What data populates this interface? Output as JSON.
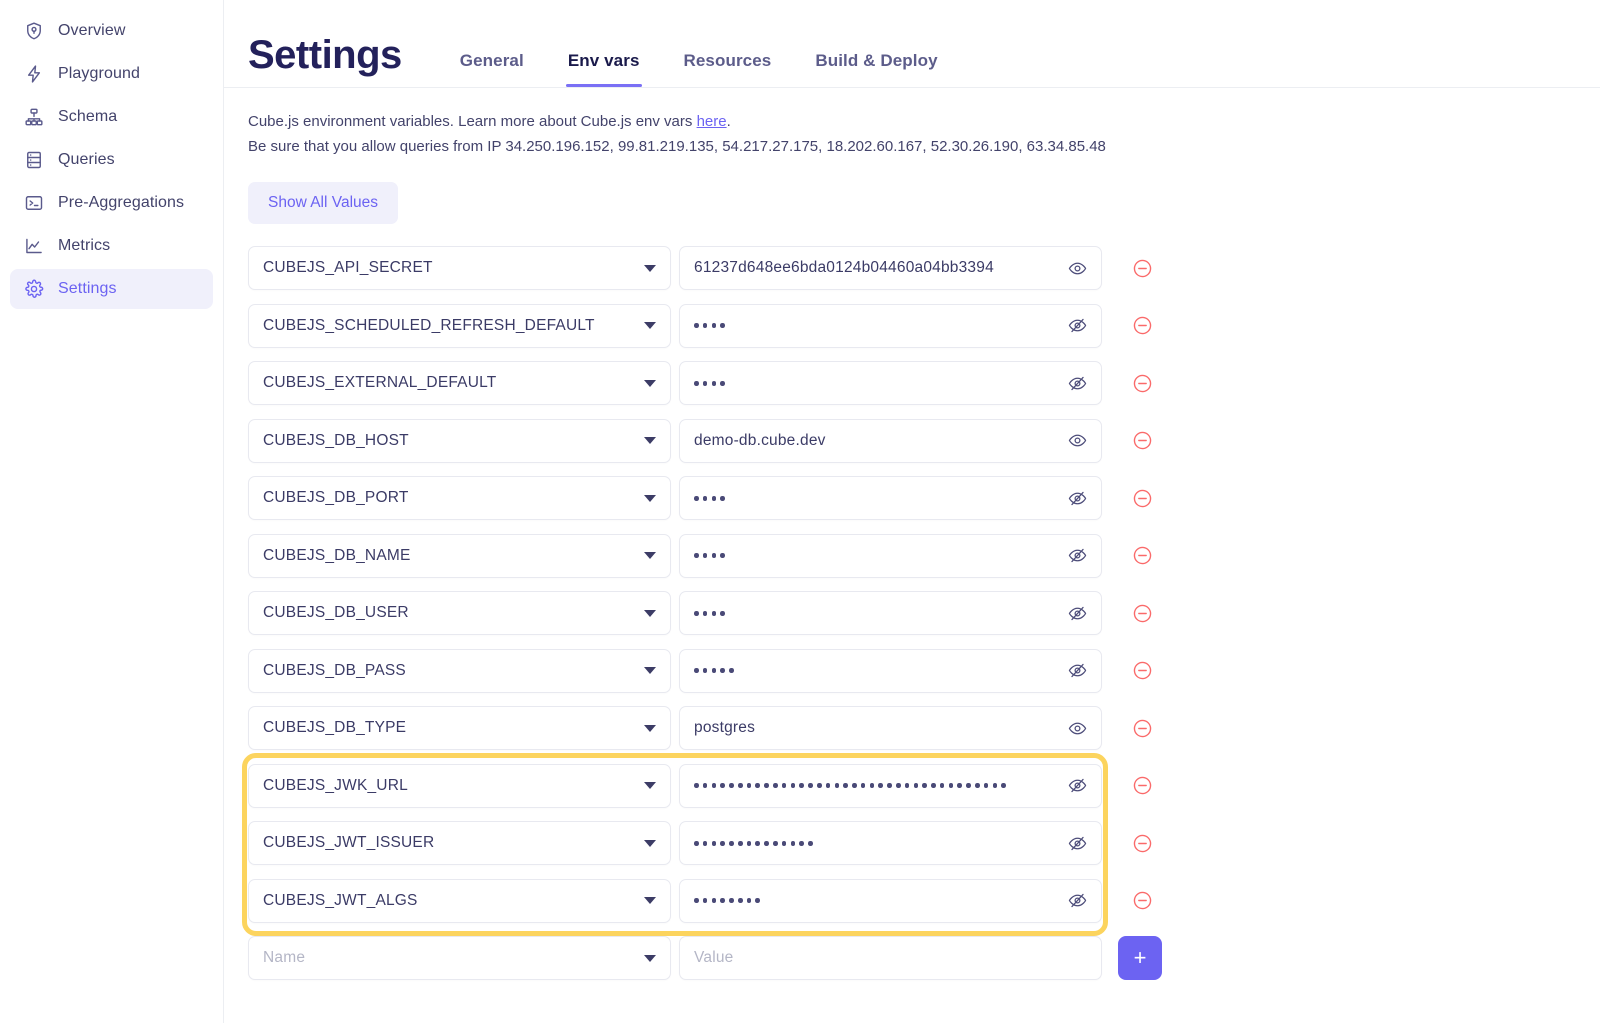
{
  "sidebar": {
    "items": [
      {
        "label": "Overview",
        "icon": "shield-overview-icon",
        "active": false
      },
      {
        "label": "Playground",
        "icon": "lightning-icon",
        "active": false
      },
      {
        "label": "Schema",
        "icon": "schema-tree-icon",
        "active": false
      },
      {
        "label": "Queries",
        "icon": "server-list-icon",
        "active": false
      },
      {
        "label": "Pre-Aggregations",
        "icon": "terminal-icon",
        "active": false
      },
      {
        "label": "Metrics",
        "icon": "line-chart-icon",
        "active": false
      },
      {
        "label": "Settings",
        "icon": "gear-icon",
        "active": true
      }
    ]
  },
  "header": {
    "title": "Settings",
    "tabs": [
      {
        "label": "General",
        "active": false
      },
      {
        "label": "Env vars",
        "active": true
      },
      {
        "label": "Resources",
        "active": false
      },
      {
        "label": "Build & Deploy",
        "active": false
      }
    ]
  },
  "description": {
    "line1_before_link": "Cube.js environment variables. Learn more about Cube.js env vars ",
    "link_text": "here",
    "line1_after_link": ".",
    "line2": "Be sure that you allow queries from IP 34.250.196.152, 99.81.219.135, 54.217.27.175, 18.202.60.167, 52.30.26.190, 63.34.85.48"
  },
  "toolbar": {
    "show_all_label": "Show All Values"
  },
  "env_vars": [
    {
      "name": "CUBEJS_API_SECRET",
      "value": "61237d648ee6bda0124b04460a04bb3394",
      "masked": false,
      "eye": "eye-icon",
      "dots": 0,
      "highlighted": false
    },
    {
      "name": "CUBEJS_SCHEDULED_REFRESH_DEFAULT",
      "value": "",
      "masked": true,
      "eye": "eye-slash-icon",
      "dots": 4,
      "highlighted": false
    },
    {
      "name": "CUBEJS_EXTERNAL_DEFAULT",
      "value": "",
      "masked": true,
      "eye": "eye-slash-icon",
      "dots": 4,
      "highlighted": false
    },
    {
      "name": "CUBEJS_DB_HOST",
      "value": "demo-db.cube.dev",
      "masked": false,
      "eye": "eye-icon",
      "dots": 0,
      "highlighted": false
    },
    {
      "name": "CUBEJS_DB_PORT",
      "value": "",
      "masked": true,
      "eye": "eye-slash-icon",
      "dots": 4,
      "highlighted": false
    },
    {
      "name": "CUBEJS_DB_NAME",
      "value": "",
      "masked": true,
      "eye": "eye-slash-icon",
      "dots": 4,
      "highlighted": false
    },
    {
      "name": "CUBEJS_DB_USER",
      "value": "",
      "masked": true,
      "eye": "eye-slash-icon",
      "dots": 4,
      "highlighted": false
    },
    {
      "name": "CUBEJS_DB_PASS",
      "value": "",
      "masked": true,
      "eye": "eye-slash-icon",
      "dots": 5,
      "highlighted": false
    },
    {
      "name": "CUBEJS_DB_TYPE",
      "value": "postgres",
      "masked": false,
      "eye": "eye-icon",
      "dots": 0,
      "highlighted": false
    },
    {
      "name": "CUBEJS_JWK_URL",
      "value": "",
      "masked": true,
      "eye": "eye-slash-icon",
      "dots": 36,
      "highlighted": true
    },
    {
      "name": "CUBEJS_JWT_ISSUER",
      "value": "",
      "masked": true,
      "eye": "eye-slash-icon",
      "dots": 14,
      "highlighted": true
    },
    {
      "name": "CUBEJS_JWT_ALGS",
      "value": "",
      "masked": true,
      "eye": "eye-slash-icon",
      "dots": 8,
      "highlighted": true
    }
  ],
  "new_row": {
    "name_placeholder": "Name",
    "value_placeholder": "Value",
    "add_label": "+"
  },
  "colors": {
    "accent": "#6c63f2",
    "title": "#23215b",
    "highlight": "#fcd45e",
    "remove": "#fa6a6a",
    "tab_underline": "#7a70f5"
  }
}
